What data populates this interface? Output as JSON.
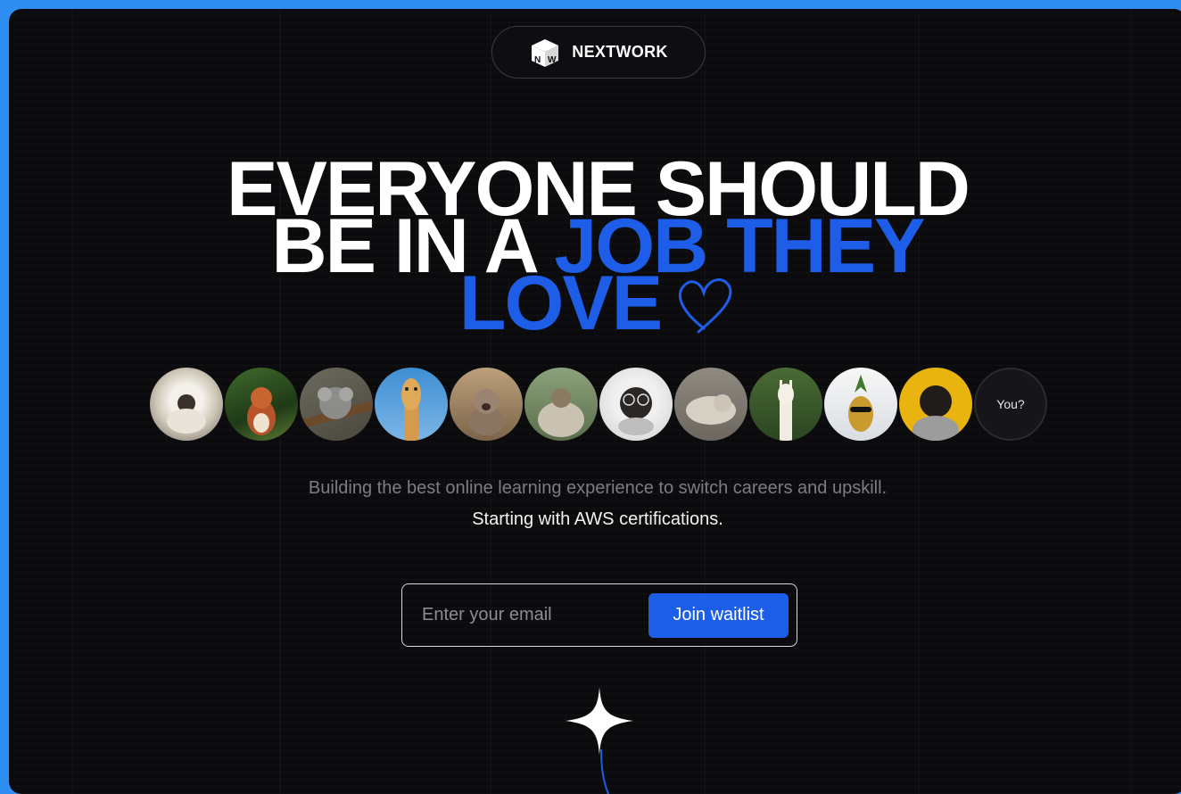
{
  "brand": {
    "name": "NEXTWORK",
    "logo_letters": "NW"
  },
  "headline": {
    "line1": "EVERYONE SHOULD",
    "line2_white": "BE IN A ",
    "line2_blue": "JOB THEY",
    "line3_blue": "LOVE"
  },
  "avatars": {
    "items": [
      "white-fluffy-dog",
      "squirrel",
      "koala",
      "giraffe",
      "kitten",
      "dog-in-blanket",
      "pug-with-glasses",
      "seal",
      "alpaca",
      "pineapple-with-sunglasses",
      "pug-in-sweater"
    ],
    "you_label": "You?"
  },
  "subtitle": "Building the best online learning experience to switch careers and upskill.",
  "subtitle2": "Starting with AWS certifications.",
  "signup": {
    "placeholder": "Enter your email",
    "button_label": "Join waitlist"
  },
  "colors": {
    "accent": "#1d5de8",
    "background": "#0b0b0e",
    "outer": "#2f8ef2"
  }
}
